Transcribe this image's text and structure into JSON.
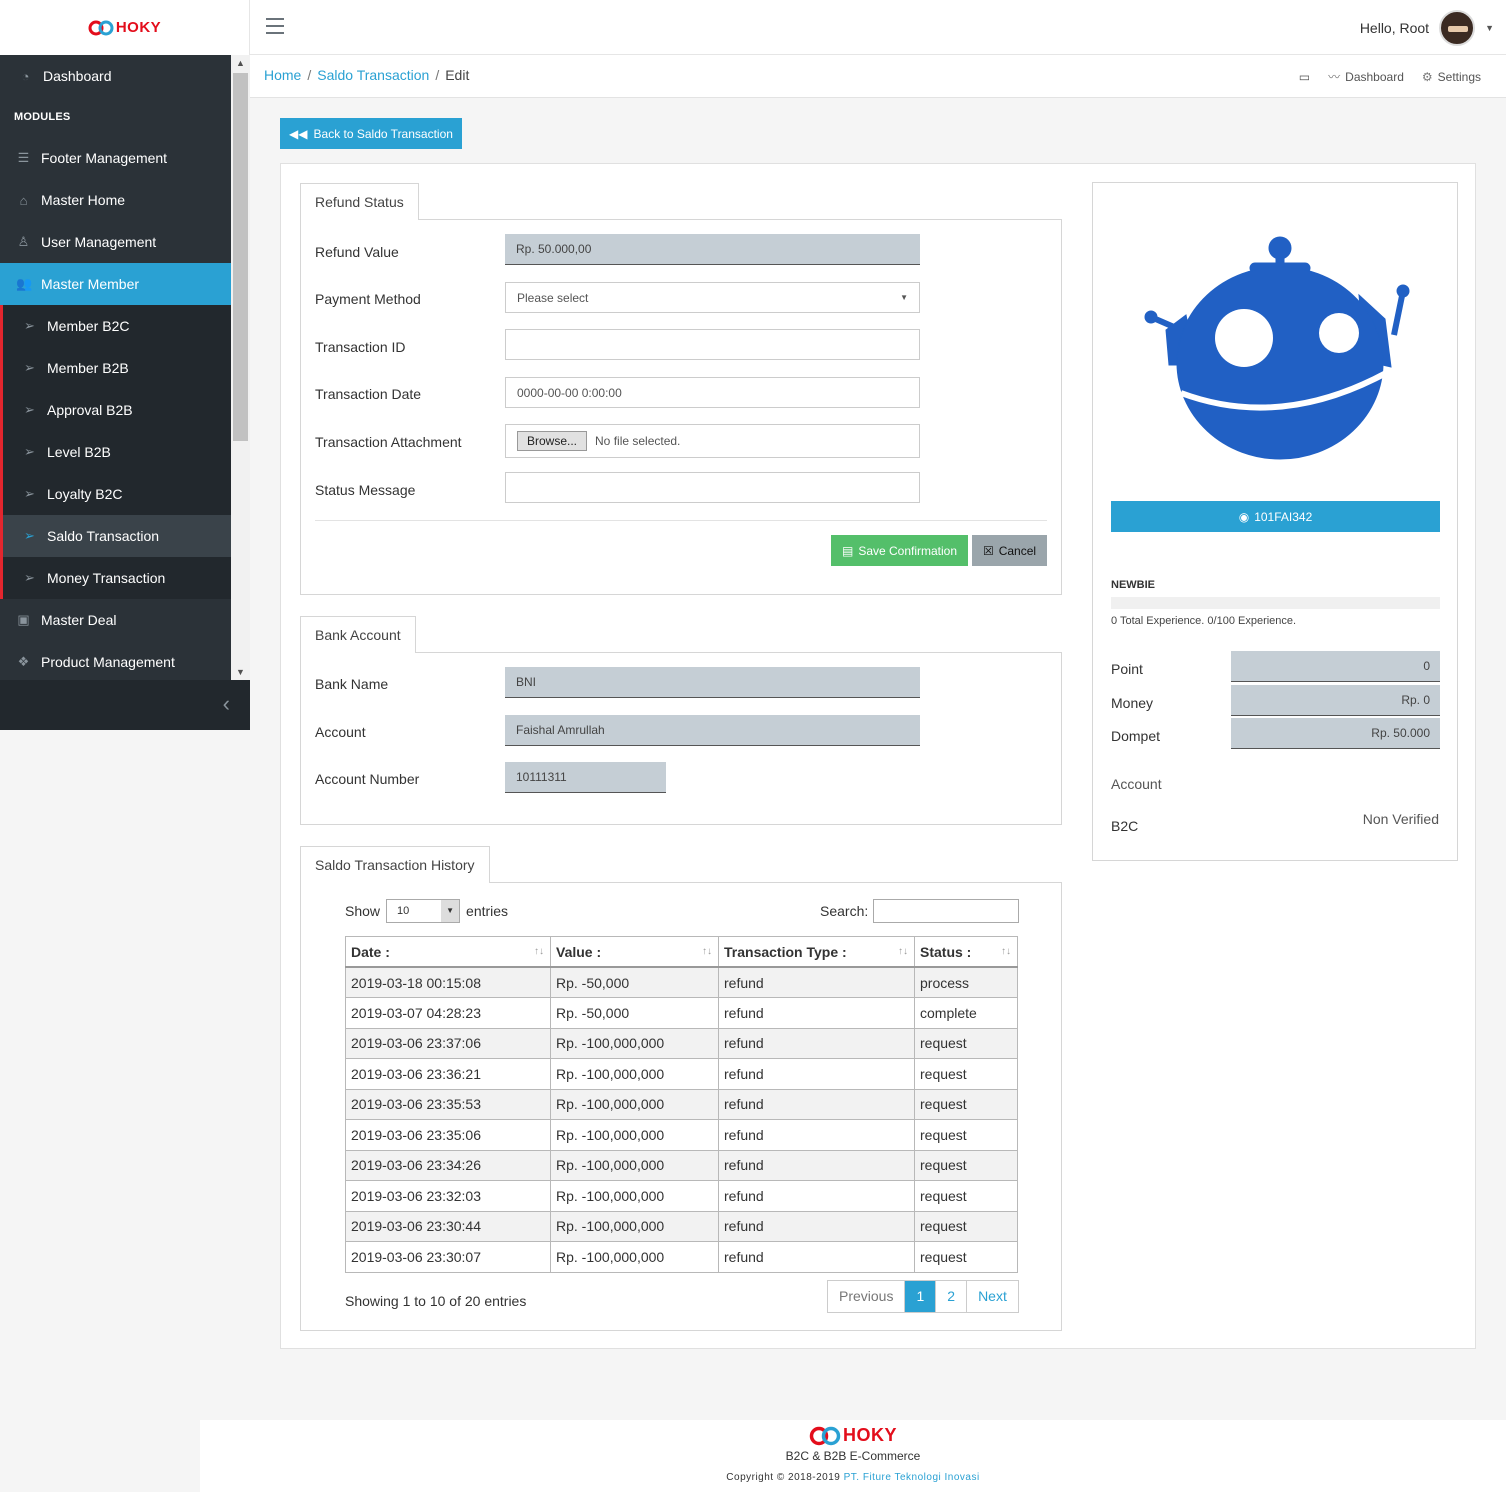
{
  "brand": {
    "name": "HOKY",
    "color": "#e30d1b"
  },
  "colors": {
    "accent": "#2aa1d3",
    "sidebar": "#2b3238",
    "success": "#54bf6a"
  },
  "sidebar": {
    "dashboard": "Dashboard",
    "modules": "MODULES",
    "items": [
      {
        "label": "Footer Management",
        "icon": "bars-icon"
      },
      {
        "label": "Master Home",
        "icon": "home-icon"
      },
      {
        "label": "User Management",
        "icon": "user-icon"
      },
      {
        "label": "Master Member",
        "icon": "users-icon"
      },
      {
        "label": "Member B2C",
        "icon": "send-icon"
      },
      {
        "label": "Member B2B",
        "icon": "send-icon"
      },
      {
        "label": "Approval B2B",
        "icon": "send-icon"
      },
      {
        "label": "Level B2B",
        "icon": "send-icon"
      },
      {
        "label": "Loyalty B2C",
        "icon": "send-icon"
      },
      {
        "label": "Saldo Transaction",
        "icon": "send-icon"
      },
      {
        "label": "Money Transaction",
        "icon": "send-icon"
      },
      {
        "label": "Master Deal",
        "icon": "money-icon"
      },
      {
        "label": "Product Management",
        "icon": "cubes-icon"
      }
    ]
  },
  "topbar": {
    "greeting": "Hello, Root"
  },
  "breadcrumb": {
    "home": "Home",
    "section": "Saldo Transaction",
    "current": "Edit"
  },
  "toolbar": {
    "dashboard": "Dashboard",
    "settings": "Settings"
  },
  "back_button": "Back to Saldo Transaction",
  "refund": {
    "tab": "Refund Status",
    "refund_value_label": "Refund Value",
    "refund_value": "Rp. 50.000,00",
    "payment_method_label": "Payment Method",
    "payment_method": "Please select",
    "transaction_id_label": "Transaction ID",
    "transaction_id": "",
    "transaction_date_label": "Transaction Date",
    "transaction_date": "0000-00-00 0:00:00",
    "attachment_label": "Transaction Attachment",
    "browse": "Browse...",
    "no_file": "No file selected.",
    "status_message_label": "Status Message",
    "status_message": "",
    "save": "Save Confirmation",
    "cancel": "Cancel"
  },
  "bank": {
    "tab": "Bank Account",
    "bank_name_label": "Bank Name",
    "bank_name": "BNI",
    "account_label": "Account",
    "account": "Faishal Amrullah",
    "account_number_label": "Account Number",
    "account_number": "10111311"
  },
  "history": {
    "tab": "Saldo Transaction History",
    "show": "Show",
    "page_size": "10",
    "entries": "entries",
    "search": "Search:",
    "columns": [
      "Date :",
      "Value :",
      "Transaction Type :",
      "Status :"
    ],
    "rows": [
      [
        "2019-03-18 00:15:08",
        "Rp. -50,000",
        "refund",
        "process"
      ],
      [
        "2019-03-07 04:28:23",
        "Rp. -50,000",
        "refund",
        "complete"
      ],
      [
        "2019-03-06 23:37:06",
        "Rp. -100,000,000",
        "refund",
        "request"
      ],
      [
        "2019-03-06 23:36:21",
        "Rp. -100,000,000",
        "refund",
        "request"
      ],
      [
        "2019-03-06 23:35:53",
        "Rp. -100,000,000",
        "refund",
        "request"
      ],
      [
        "2019-03-06 23:35:06",
        "Rp. -100,000,000",
        "refund",
        "request"
      ],
      [
        "2019-03-06 23:34:26",
        "Rp. -100,000,000",
        "refund",
        "request"
      ],
      [
        "2019-03-06 23:32:03",
        "Rp. -100,000,000",
        "refund",
        "request"
      ],
      [
        "2019-03-06 23:30:44",
        "Rp. -100,000,000",
        "refund",
        "request"
      ],
      [
        "2019-03-06 23:30:07",
        "Rp. -100,000,000",
        "refund",
        "request"
      ]
    ],
    "info": "Showing 1 to 10 of 20 entries",
    "prev": "Previous",
    "pages": [
      "1",
      "2"
    ],
    "next": "Next"
  },
  "profile": {
    "member_id": "101FAI342",
    "level": "NEWBIE",
    "progress": 0,
    "experience": "0 Total Experience. 0/100 Experience.",
    "point_label": "Point",
    "point": "0",
    "money_label": "Money",
    "money": "Rp. 0",
    "dompet_label": "Dompet",
    "dompet": "Rp. 50.000",
    "account_label": "Account",
    "type": "B2C",
    "verification": "Non Verified"
  },
  "footer": {
    "subtitle": "B2C & B2B E-Commerce",
    "copyright": "Copyright © 2018-2019",
    "company": "PT. Fiture Teknologi Inovasi"
  }
}
